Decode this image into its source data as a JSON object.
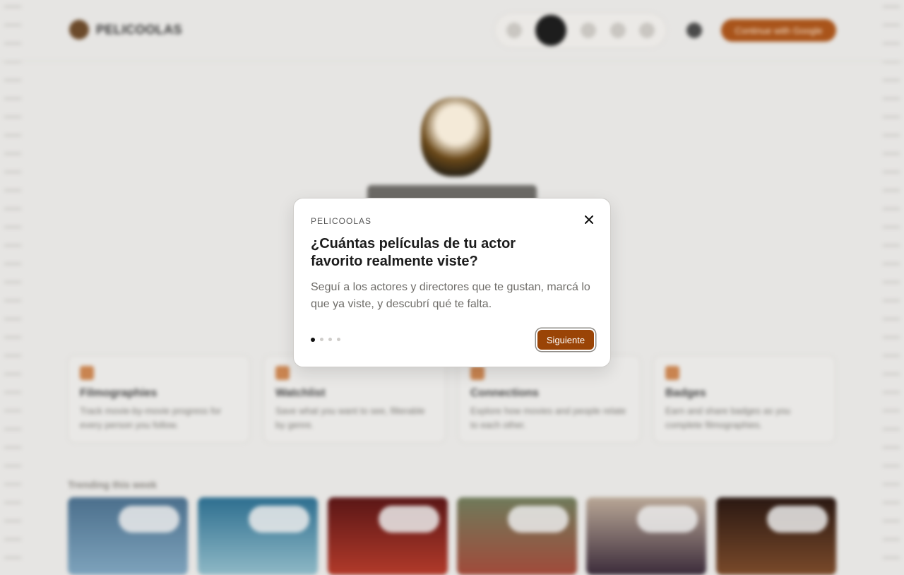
{
  "background": {
    "brand_name": "PELICOOLAS",
    "nav_icons": [
      "search-icon",
      "home-icon",
      "eye-icon",
      "bookmark-icon",
      "user-icon"
    ],
    "cta_label": "Continue with Google",
    "features": [
      {
        "icon": "film-icon",
        "title": "Filmographies",
        "desc": "Track movie-by-movie progress for every person you follow."
      },
      {
        "icon": "bookmark-icon",
        "title": "Watchlist",
        "desc": "Save what you want to see, filterable by genre."
      },
      {
        "icon": "network-icon",
        "title": "Connections",
        "desc": "Explore how movies and people relate to each other."
      },
      {
        "icon": "trophy-icon",
        "title": "Badges",
        "desc": "Earn and share badges as you complete filmographies."
      }
    ],
    "trending_title": "Trending this week"
  },
  "modal": {
    "eyebrow": "PELICOOLAS",
    "title": "¿Cuántas películas de tu actor favorito realmente viste?",
    "body": "Seguí a los actores y directores que te gustan, marcá lo que ya viste, y descubrí qué te falta.",
    "next_label": "Siguiente",
    "steps_total": 4,
    "step_current": 1,
    "close_icon": "close-icon"
  },
  "colors": {
    "accent": "#9a4406",
    "overlay": "#e6e5e3"
  }
}
